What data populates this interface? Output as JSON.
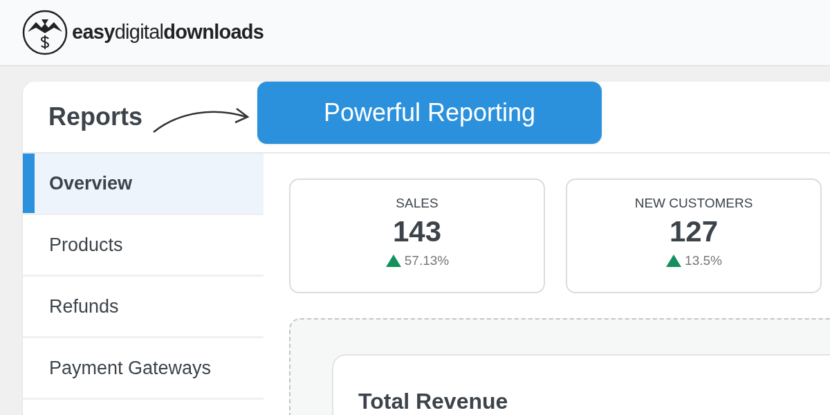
{
  "header": {
    "logo_text": "**easy**digital**downloads**"
  },
  "page": {
    "title": "Reports",
    "callout": "Powerful Reporting"
  },
  "sidebar": {
    "items": [
      {
        "label": "Overview",
        "selected": true
      },
      {
        "label": "Products",
        "selected": false
      },
      {
        "label": "Refunds",
        "selected": false
      },
      {
        "label": "Payment Gateways",
        "selected": false
      }
    ]
  },
  "stats": [
    {
      "label": "SALES",
      "value": "143",
      "change": "57.13%",
      "rising": true
    },
    {
      "label": "NEW CUSTOMERS",
      "value": "127",
      "change": "13.5%",
      "rising": true
    }
  ],
  "revenue": {
    "title": "Total Revenue"
  }
}
